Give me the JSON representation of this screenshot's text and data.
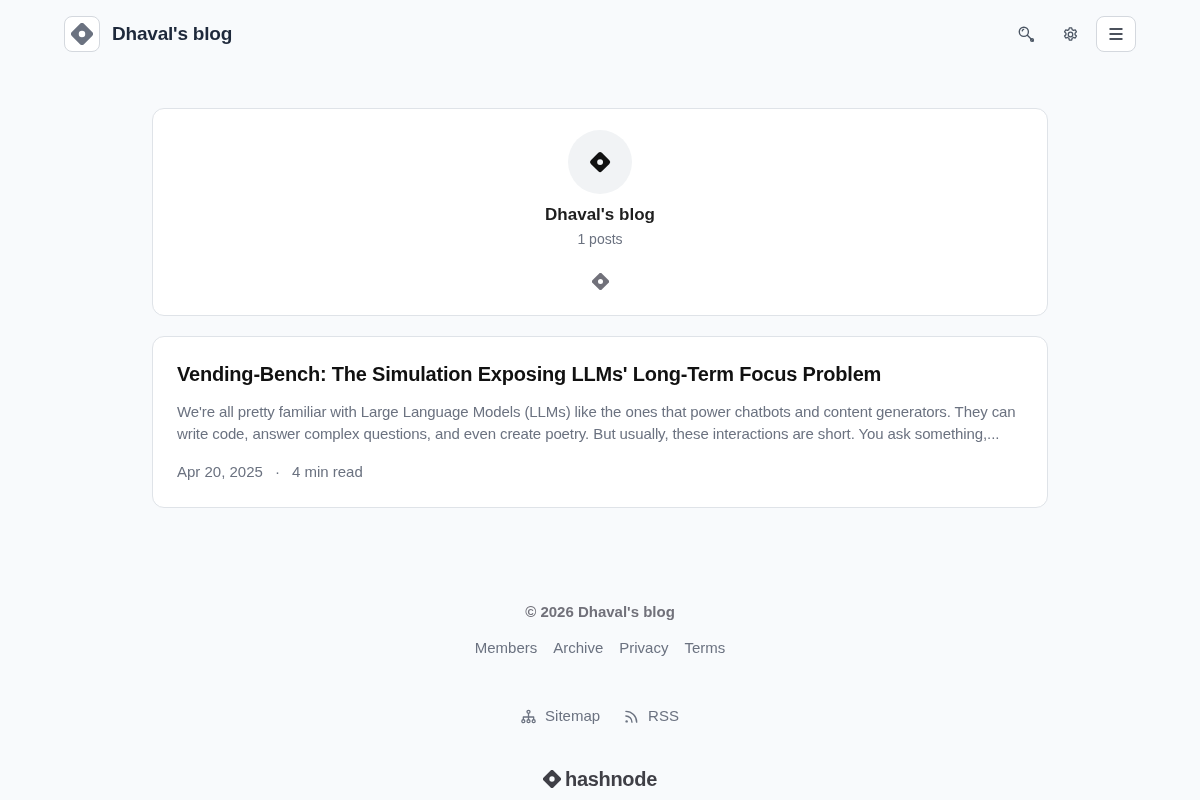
{
  "header": {
    "blog_title": "Dhaval's blog"
  },
  "profile_card": {
    "name": "Dhaval's blog",
    "post_count": "1 posts"
  },
  "posts": [
    {
      "title": "Vending-Bench: The Simulation Exposing LLMs' Long-Term Focus Problem",
      "excerpt": "We're all pretty familiar with Large Language Models (LLMs) like the ones that power chatbots and content generators. They can write code, answer complex questions, and even create poetry. But usually, these interactions are short. You ask something,...",
      "date": "Apr 20, 2025",
      "separator": "·",
      "read_time": "4 min read"
    }
  ],
  "footer": {
    "copyright": "© 2026 Dhaval's blog",
    "links": [
      "Members",
      "Archive",
      "Privacy",
      "Terms"
    ],
    "feeds": [
      {
        "kind": "sitemap",
        "label": "Sitemap"
      },
      {
        "kind": "rss",
        "label": "RSS"
      }
    ],
    "brand": "hashnode"
  }
}
